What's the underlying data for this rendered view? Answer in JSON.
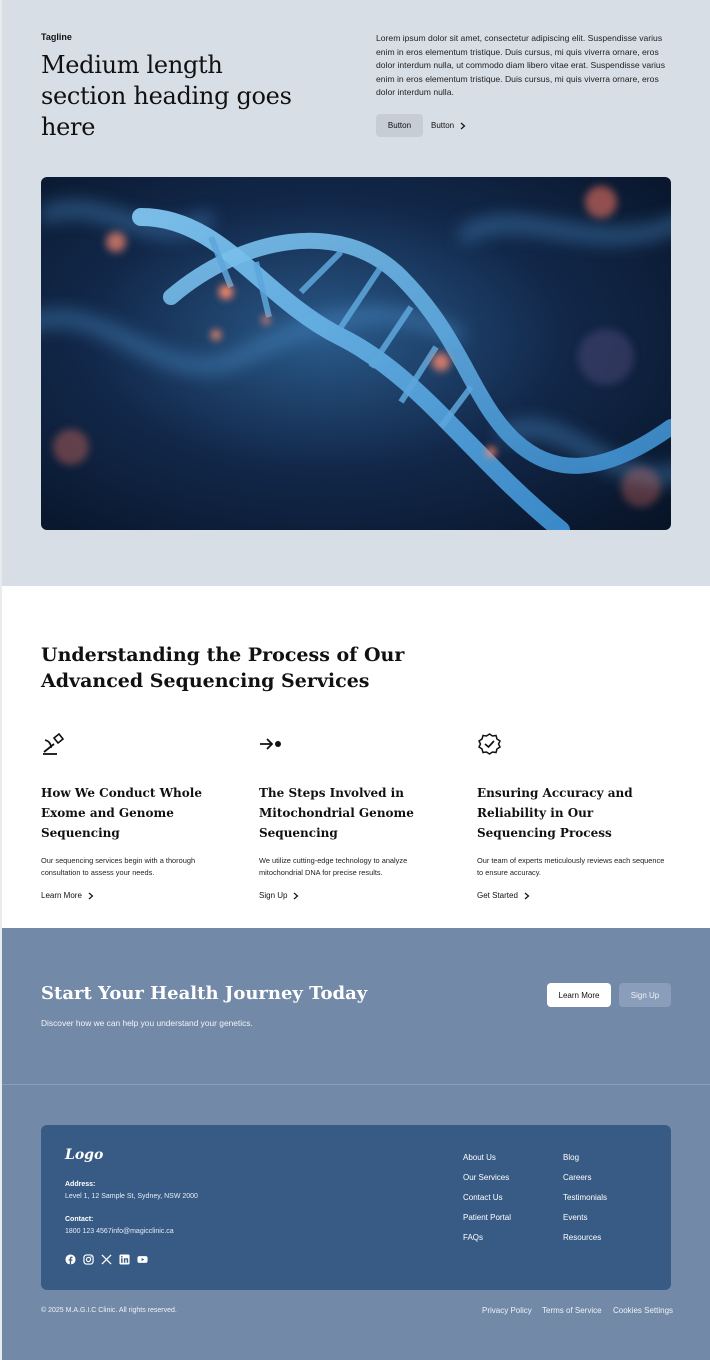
{
  "hero": {
    "tagline": "Tagline",
    "heading": "Medium length section heading goes here",
    "body": "Lorem ipsum dolor sit amet, consectetur adipiscing elit. Suspendisse varius enim in eros elementum tristique. Duis cursus, mi quis viverra ornare, eros dolor interdum nulla, ut commodo diam libero vitae erat. Suspendisse varius enim in eros elementum tristique. Duis cursus, mi quis viverra ornare, eros dolor interdum nulla.",
    "primary_button": "Button",
    "secondary_button": "Button",
    "image_icon": "dna-helix-image"
  },
  "process": {
    "heading": "Understanding the Process of Our Advanced Sequencing Services",
    "columns": [
      {
        "icon": "microscope-icon",
        "title": "How We Conduct Whole Exome and Genome Sequencing",
        "body": "Our sequencing services begin with a thorough consultation to assess your needs.",
        "link": "Learn More"
      },
      {
        "icon": "arrow-dot-icon",
        "title": "The Steps Involved in Mitochondrial Genome Sequencing",
        "body": "We utilize cutting-edge technology to analyze mitochondrial DNA for precise results.",
        "link": "Sign Up"
      },
      {
        "icon": "verified-badge-icon",
        "title": "Ensuring Accuracy and Reliability in Our Sequencing Process",
        "body": "Our team of experts meticulously reviews each sequence to ensure accuracy.",
        "link": "Get Started"
      }
    ]
  },
  "cta": {
    "heading": "Start Your Health Journey Today",
    "body": "Discover how we can help you understand your genetics.",
    "primary_button": "Learn More",
    "secondary_button": "Sign Up"
  },
  "footer": {
    "logo": "Logo",
    "address_label": "Address:",
    "address": "Level 1, 12 Sample St, Sydney, NSW 2000",
    "contact_label": "Contact:",
    "contact": "1800 123 4567info@magicclinic.ca",
    "nav_col1": [
      "About Us",
      "Our Services",
      "Contact Us",
      "Patient Portal",
      "FAQs"
    ],
    "nav_col2": [
      "Blog",
      "Careers",
      "Testimonials",
      "Events",
      "Resources"
    ],
    "socials": [
      "facebook-icon",
      "instagram-icon",
      "x-icon",
      "linkedin-icon",
      "youtube-icon"
    ],
    "copyright": "© 2025 M.A.G.I.C Clinic. All rights reserved.",
    "legal": [
      "Privacy Policy",
      "Terms of Service",
      "Cookies Settings"
    ]
  },
  "colors": {
    "hero_bg": "#d8dee6",
    "cta_bg": "#7389a8",
    "footer_card_bg": "#375b85"
  }
}
